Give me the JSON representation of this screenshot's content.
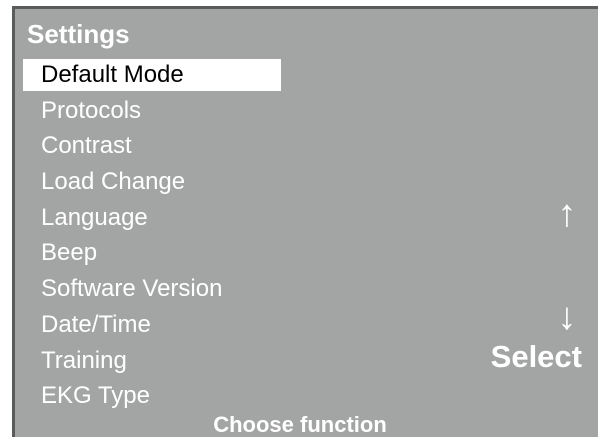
{
  "screen": {
    "title": "Settings",
    "status_text": "Choose function",
    "colors": {
      "background": "#a3a5a4",
      "text": "#ffffff",
      "selection_bg": "#ffffff",
      "selection_text": "#000000"
    }
  },
  "menu": {
    "selected_index": 0,
    "items": [
      {
        "label": "Default Mode"
      },
      {
        "label": "Protocols"
      },
      {
        "label": "Contrast"
      },
      {
        "label": "Load Change"
      },
      {
        "label": "Language"
      },
      {
        "label": "Beep"
      },
      {
        "label": "Software Version"
      },
      {
        "label": "Date/Time"
      },
      {
        "label": "Training"
      },
      {
        "label": "EKG Type"
      }
    ]
  },
  "softkeys": {
    "up_arrow": "↑",
    "up_icon": "arrow-up-icon",
    "down_arrow": "↓",
    "down_icon": "arrow-down-icon",
    "select_label": "Select"
  }
}
